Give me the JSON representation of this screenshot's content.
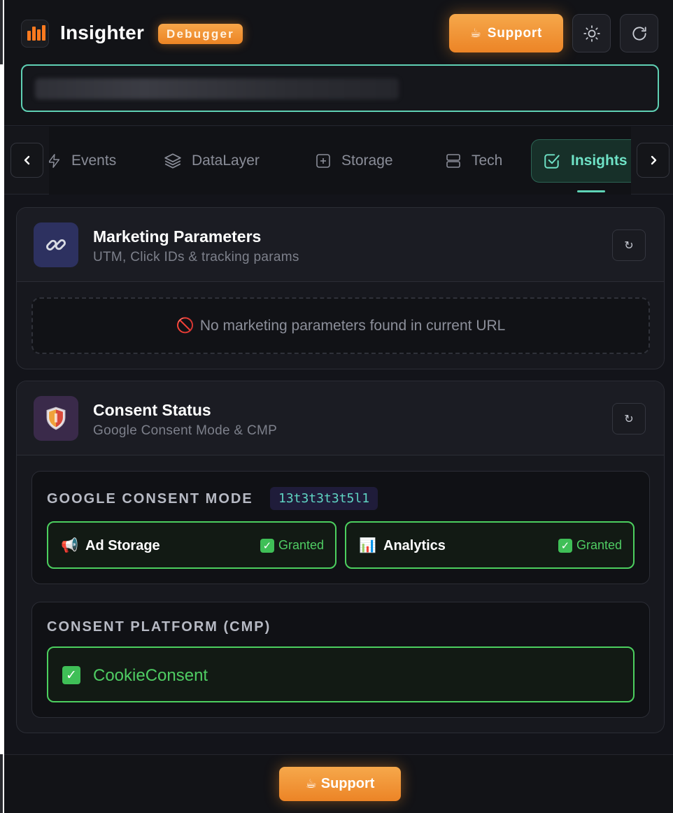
{
  "header": {
    "app_title": "Insighter",
    "badge": "Debugger",
    "support_label": "Support",
    "support_icon": "coffee-cup-icon",
    "theme_icon": "sun-icon",
    "reload_icon": "refresh-icon"
  },
  "url_field": {
    "value": "",
    "note_icon": "blurred-url"
  },
  "tabs": [
    {
      "label": "Events",
      "icon": "lightning-icon",
      "active": false
    },
    {
      "label": "DataLayer",
      "icon": "layers-icon",
      "active": false
    },
    {
      "label": "Storage",
      "icon": "storage-box-icon",
      "active": false
    },
    {
      "label": "Tech",
      "icon": "server-icon",
      "active": false
    },
    {
      "label": "Insights",
      "icon": "checkbox-icon",
      "active": true
    }
  ],
  "marketing": {
    "title": "Marketing Parameters",
    "subtitle": "UTM, Click IDs & tracking params",
    "empty_icon": "🚫",
    "empty_text": "No marketing parameters found in current URL",
    "refresh_glyph": "↻"
  },
  "consent": {
    "title": "Consent Status",
    "subtitle": "Google Consent Mode & CMP",
    "refresh_glyph": "↻",
    "gcm": {
      "label": "GOOGLE CONSENT MODE",
      "mode_code": "13t3t3t3t5l1",
      "items": [
        {
          "icon": "📢",
          "label": "Ad Storage",
          "status": "Granted"
        },
        {
          "icon": "📊",
          "label": "Analytics",
          "status": "Granted"
        }
      ]
    },
    "cmp": {
      "label": "CONSENT PLATFORM (CMP)",
      "name": "CookieConsent"
    }
  },
  "footer": {
    "support_label": "Support"
  },
  "colors": {
    "accent": "#5fd4b7",
    "orange": "#ef8a2a",
    "granted": "#4fcc63"
  }
}
